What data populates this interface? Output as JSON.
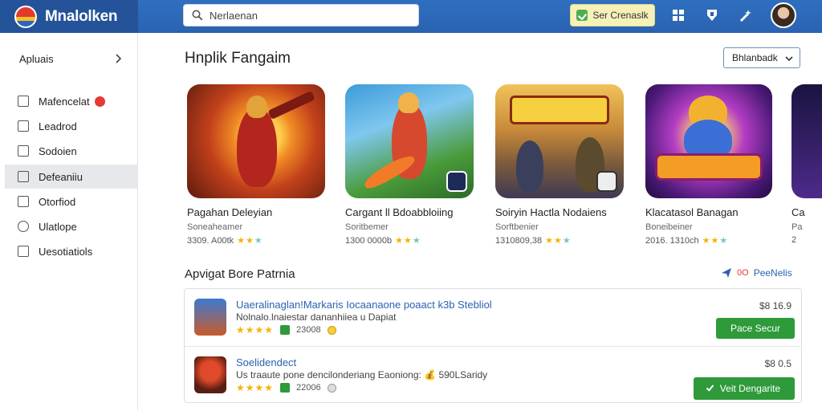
{
  "brand": {
    "name": "Mnalolken"
  },
  "search": {
    "value": "Nerlaenan"
  },
  "topbar": {
    "cta_label": "Ser Crenaslk",
    "icons": [
      "grid-icon",
      "shield-icon",
      "wand-icon"
    ]
  },
  "sidebar": {
    "header": "Apluais",
    "items": [
      {
        "label": "Mafencelat",
        "icon": "file-icon",
        "badge": true,
        "active": false
      },
      {
        "label": "Leadrod",
        "icon": "download-icon",
        "badge": false,
        "active": false
      },
      {
        "label": "Sodoien",
        "icon": "check-icon",
        "badge": false,
        "active": false
      },
      {
        "label": "Defeaniiu",
        "icon": "folder-icon",
        "badge": false,
        "active": true
      },
      {
        "label": "Otorfiod",
        "icon": "window-icon",
        "badge": false,
        "active": false
      },
      {
        "label": "Ulatlope",
        "icon": "globe-icon",
        "badge": false,
        "active": false
      },
      {
        "label": "Uesotiatiols",
        "icon": "list-icon",
        "badge": false,
        "active": false
      }
    ]
  },
  "featured": {
    "title": "Hnplik Fangaim",
    "sort_label": "Bhlanbadk",
    "cards": [
      {
        "name": "Pagahan Deleyian",
        "sub": "Soneaheamer",
        "meta": "3309. A00tk"
      },
      {
        "name": "Cargant ll Bdoabbloiing",
        "sub": "Soritbemer",
        "meta": "1300 0000b"
      },
      {
        "name": "Soiryin Hactla Nodaiens",
        "sub": "Sorftbenier",
        "meta": "1310809,38"
      },
      {
        "name": "Klacatasol Banagan",
        "sub": "Boneibeiner",
        "meta": "2016. 1310ch"
      },
      {
        "name": "Ca",
        "sub": "Pa",
        "meta": "2"
      }
    ]
  },
  "popular": {
    "title": "Apvigat Bore Patrnia",
    "link_badge": "0O",
    "link_label": "PeeNelis",
    "rows": [
      {
        "title": "Uaeralinaglan!Markaris Iocaanaone poaact k3b Stebliol",
        "desc": "Nolnalo.lnaiestar dananhiiea u Dapiat",
        "stars": "★★★★",
        "count": "23008",
        "price": "$8 16.9",
        "button": "Pace Secur",
        "coin": "gold"
      },
      {
        "title": "Soelidendect",
        "desc": "Us traaute pone dencilonderiang Eaoniong: 💰 590LSaridy",
        "stars": "★★★★",
        "count": "22006",
        "price": "$8 0.5",
        "button": "Veit Dengarite",
        "coin": "grey"
      }
    ]
  }
}
